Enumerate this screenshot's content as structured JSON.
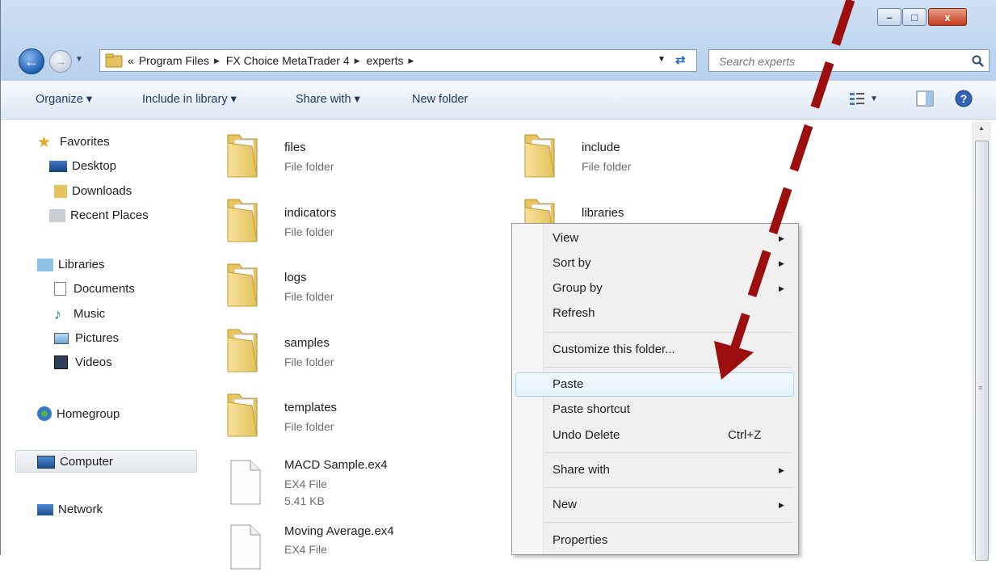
{
  "window": {
    "minimize": "–",
    "maximize": "□",
    "close": "x"
  },
  "address": {
    "overflow": "«",
    "crumbs": [
      "Program Files",
      "FX Choice MetaTrader 4",
      "experts"
    ]
  },
  "search": {
    "placeholder": "Search experts"
  },
  "toolbar": {
    "organize": "Organize ▾",
    "include_in_library": "Include in library ▾",
    "share_with": "Share with ▾",
    "new_folder": "New folder"
  },
  "sidebar": {
    "favorites": "Favorites",
    "desktop": "Desktop",
    "downloads": "Downloads",
    "recent_places": "Recent Places",
    "libraries": "Libraries",
    "documents": "Documents",
    "music": "Music",
    "pictures": "Pictures",
    "videos": "Videos",
    "homegroup": "Homegroup",
    "computer": "Computer",
    "network": "Network"
  },
  "items": [
    {
      "name": "files",
      "type": "File folder"
    },
    {
      "name": "include",
      "type": "File folder"
    },
    {
      "name": "indicators",
      "type": "File folder"
    },
    {
      "name": "libraries",
      "type": ""
    },
    {
      "name": "logs",
      "type": "File folder"
    },
    {
      "name": "samples",
      "type": "File folder"
    },
    {
      "name": "templates",
      "type": "File folder"
    },
    {
      "name": "MACD Sample.ex4",
      "type": "EX4 File",
      "size": "5.41 KB"
    },
    {
      "name": "Moving Average.ex4",
      "type": "EX4 File"
    }
  ],
  "context_menu": {
    "view": "View",
    "sort_by": "Sort by",
    "group_by": "Group by",
    "refresh": "Refresh",
    "customize": "Customize this folder...",
    "paste": "Paste",
    "paste_shortcut": "Paste shortcut",
    "undo_delete": "Undo Delete",
    "undo_shortcut": "Ctrl+Z",
    "share_with": "Share with",
    "new": "New",
    "properties": "Properties"
  },
  "colors": {
    "annotation_arrow": "#9b0f0f",
    "menu_hover": "#e1f1fa"
  }
}
